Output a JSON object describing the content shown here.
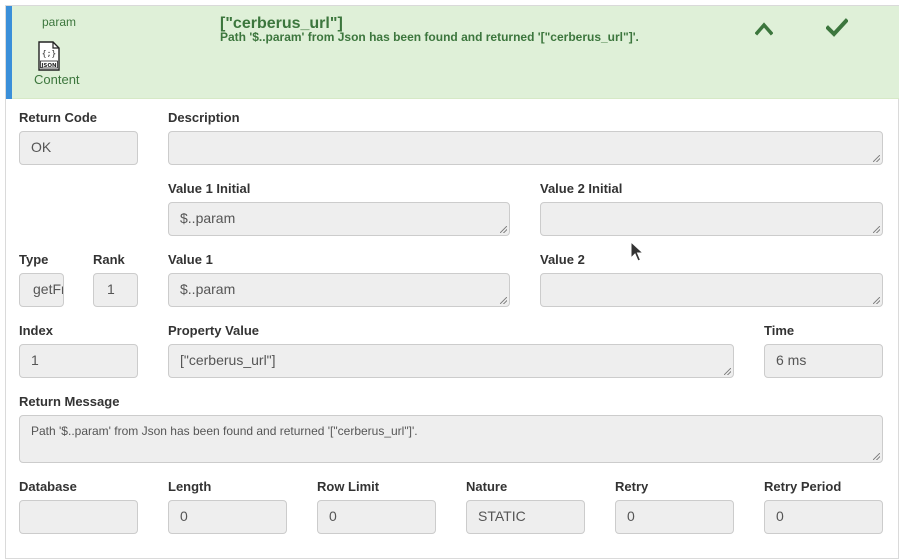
{
  "header": {
    "param_name": "param",
    "content_label": "Content",
    "json_badge": "JSON",
    "property_title": "[\"cerberus_url\"]",
    "property_message": "Path '$..param' from Json has been found and returned '[\"cerberus_url\"]'.",
    "status_color": "#3c763d",
    "background_color": "#dff0d8",
    "accent_color": "#3a8fd9",
    "icons": [
      "json-file-icon",
      "chevron-up-icon",
      "checkmark-icon"
    ]
  },
  "form": {
    "return_code": {
      "label": "Return Code",
      "value": "OK"
    },
    "description": {
      "label": "Description",
      "value": ""
    },
    "value1_initial": {
      "label": "Value 1 Initial",
      "value": "$..param"
    },
    "value2_initial": {
      "label": "Value 2 Initial",
      "value": ""
    },
    "type": {
      "label": "Type",
      "value": "getFromJson"
    },
    "rank": {
      "label": "Rank",
      "value": "1"
    },
    "value1": {
      "label": "Value 1",
      "value": "$..param"
    },
    "value2": {
      "label": "Value 2",
      "value": ""
    },
    "index": {
      "label": "Index",
      "value": "1"
    },
    "property_value": {
      "label": "Property Value",
      "value": "[\"cerberus_url\"]"
    },
    "time": {
      "label": "Time",
      "value": "6 ms"
    },
    "return_message": {
      "label": "Return Message",
      "value": "Path '$..param' from Json has been found and returned '[\"cerberus_url\"]'."
    },
    "database": {
      "label": "Database",
      "value": ""
    },
    "length": {
      "label": "Length",
      "value": "0"
    },
    "row_limit": {
      "label": "Row Limit",
      "value": "0"
    },
    "nature": {
      "label": "Nature",
      "value": "STATIC"
    },
    "retry": {
      "label": "Retry",
      "value": "0"
    },
    "retry_period": {
      "label": "Retry Period",
      "value": "0"
    }
  }
}
